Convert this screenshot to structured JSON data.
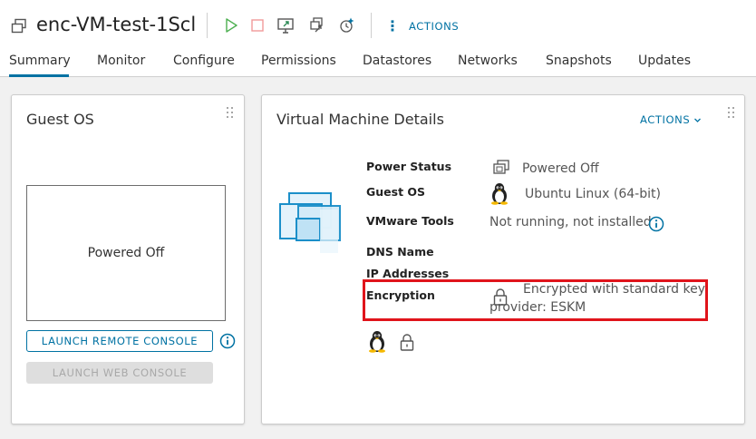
{
  "header": {
    "vm_name": "enc-VM-test-1Scl",
    "actions_label": "ACTIONS",
    "tool_icons": [
      "power-on-icon",
      "power-off-icon",
      "launch-console-icon",
      "migrate-icon",
      "snapshot-icon"
    ]
  },
  "tabs": [
    {
      "label": "Summary",
      "active": true
    },
    {
      "label": "Monitor",
      "active": false
    },
    {
      "label": "Configure",
      "active": false
    },
    {
      "label": "Permissions",
      "active": false
    },
    {
      "label": "Datastores",
      "active": false
    },
    {
      "label": "Networks",
      "active": false
    },
    {
      "label": "Snapshots",
      "active": false
    },
    {
      "label": "Updates",
      "active": false
    }
  ],
  "guest_os_card": {
    "title": "Guest OS",
    "console_status": "Powered Off",
    "launch_remote_console": "LAUNCH REMOTE CONSOLE",
    "launch_web_console": "LAUNCH WEB CONSOLE"
  },
  "vm_details_card": {
    "title": "Virtual Machine Details",
    "actions_label": "ACTIONS",
    "rows": {
      "power_status": {
        "label": "Power Status",
        "value": "Powered Off"
      },
      "guest_os": {
        "label": "Guest OS",
        "value": "Ubuntu Linux (64-bit)"
      },
      "vmware_tools": {
        "label": "VMware Tools",
        "value": "Not running, not installed"
      },
      "dns_name": {
        "label": "DNS Name",
        "value": ""
      },
      "ip_addresses": {
        "label": "IP Addresses",
        "value": ""
      },
      "encryption": {
        "label": "Encryption",
        "value_line1": "Encrypted with standard key",
        "value_line2": "provider: ESKM"
      }
    }
  },
  "colors": {
    "accent": "#0072a3",
    "highlight": "#e0141b",
    "power_on": "#4caf50",
    "power_off": "#e57373"
  }
}
